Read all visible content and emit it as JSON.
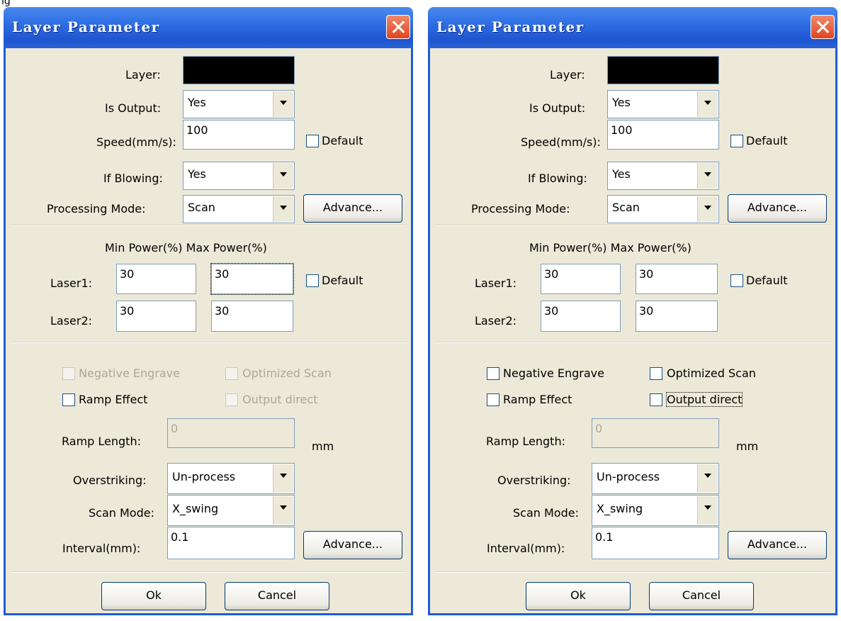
{
  "caption": "ig",
  "dialogs": [
    {
      "title": "Layer Parameter",
      "layer_label": "Layer:",
      "is_output_label": "Is Output:",
      "is_output_value": "Yes",
      "speed_label": "Speed(mm/s):",
      "speed_value": "100",
      "speed_default_label": "Default",
      "blowing_label": "If Blowing:",
      "blowing_value": "Yes",
      "mode_label": "Processing Mode:",
      "mode_value": "Scan",
      "advance1_label": "Advance...",
      "power_header": "Min Power(%) Max Power(%)",
      "laser1_label": "Laser1:",
      "laser1_min": "30",
      "laser1_max": "30",
      "power_default_label": "Default",
      "laser2_label": "Laser2:",
      "laser2_min": "30",
      "laser2_max": "30",
      "negative_label": "Negative Engrave",
      "optimized_label": "Optimized Scan",
      "ramp_effect_label": "Ramp Effect",
      "output_direct_label": "Output direct",
      "ramp_length_label": "Ramp Length:",
      "ramp_length_value": "0",
      "mm_label": "mm",
      "overstriking_label": "Overstriking:",
      "overstriking_value": "Un-process",
      "scan_mode_label": "Scan Mode:",
      "scan_mode_value": "X_swing",
      "interval_label": "Interval(mm):",
      "interval_value": "0.1",
      "advance2_label": "Advance...",
      "ok_label": "Ok",
      "cancel_label": "Cancel"
    },
    {
      "title": "Layer Parameter",
      "layer_label": "Layer:",
      "is_output_label": "Is Output:",
      "is_output_value": "Yes",
      "speed_label": "Speed(mm/s):",
      "speed_value": "100",
      "speed_default_label": "Default",
      "blowing_label": "If Blowing:",
      "blowing_value": "Yes",
      "mode_label": "Processing Mode:",
      "mode_value": "Scan",
      "advance1_label": "Advance...",
      "power_header": "Min Power(%) Max Power(%)",
      "laser1_label": "Laser1:",
      "laser1_min": "30",
      "laser1_max": "30",
      "power_default_label": "Default",
      "laser2_label": "Laser2:",
      "laser2_min": "30",
      "laser2_max": "30",
      "negative_label": "Negative Engrave",
      "optimized_label": "Optimized Scan",
      "ramp_effect_label": "Ramp Effect",
      "output_direct_label": "Output direct",
      "ramp_length_label": "Ramp Length:",
      "ramp_length_value": "0",
      "mm_label": "mm",
      "overstriking_label": "Overstriking:",
      "overstriking_value": "Un-process",
      "scan_mode_label": "Scan Mode:",
      "scan_mode_value": "X_swing",
      "interval_label": "Interval(mm):",
      "interval_value": "0.1",
      "advance2_label": "Advance...",
      "ok_label": "Ok",
      "cancel_label": "Cancel"
    }
  ],
  "colors": {
    "titlebar": "#2f6ee3",
    "dialog_bg": "#ece9d8",
    "close_button": "#e0451f"
  },
  "icons": {
    "close": "close-icon",
    "dropdown": "chevron-down-icon"
  }
}
